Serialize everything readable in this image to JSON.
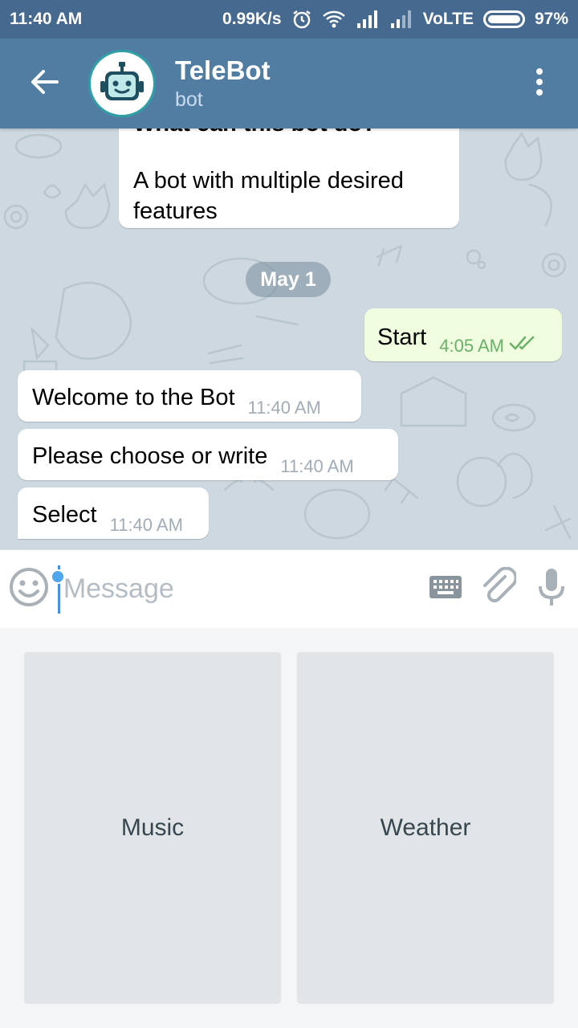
{
  "status_bar": {
    "time": "11:40 AM",
    "speed": "0.99K/s",
    "network": "VoLTE",
    "battery": "97%"
  },
  "header": {
    "title": "TeleBot",
    "subtitle": "bot",
    "back_icon": "arrow-left-icon",
    "menu_icon": "more-vertical-icon"
  },
  "chat": {
    "bot_description": {
      "heading": "What can this bot do?",
      "text": "A bot with multiple desired features"
    },
    "date_label": "May 1",
    "outgoing": {
      "text": "Start",
      "time": "4:05 AM"
    },
    "incoming": [
      {
        "text": "Welcome to the Bot",
        "time": "11:40 AM"
      },
      {
        "text": "Please choose or write",
        "time": "11:40 AM"
      },
      {
        "text": "Select",
        "time": "11:40 AM"
      }
    ]
  },
  "input_bar": {
    "placeholder": "Message"
  },
  "keyboard": {
    "buttons": [
      "Music",
      "Weather"
    ]
  },
  "colors": {
    "status_bar": "#45698f",
    "header": "#527da3",
    "chat_bg": "#cdd8e0",
    "outgoing_bubble": "#effdde",
    "keyboard_button": "#e2e5e8"
  }
}
